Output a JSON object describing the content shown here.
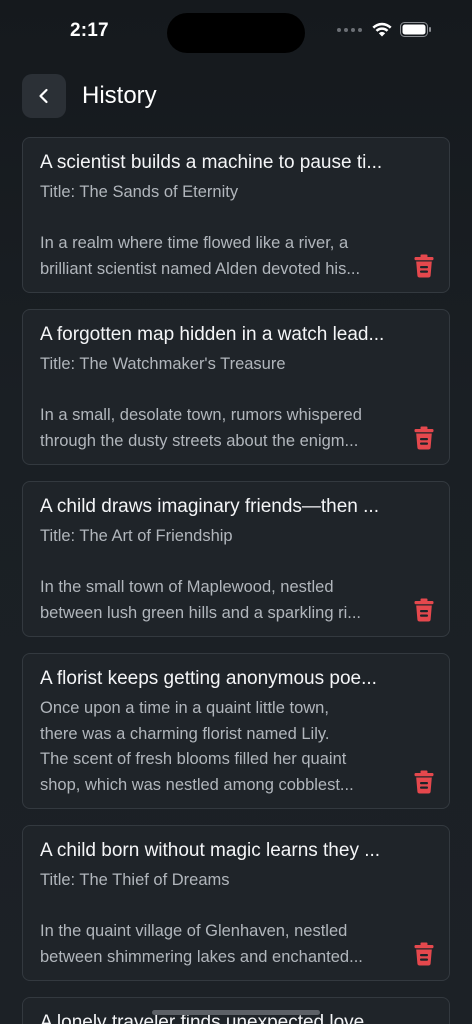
{
  "status_bar": {
    "time": "2:17"
  },
  "header": {
    "title": "History"
  },
  "colors": {
    "accent_delete": "#e5484d",
    "card_bg": "#1f2429",
    "background": "#15191d"
  },
  "history": [
    {
      "title": "A scientist builds a machine to pause ti...",
      "lines": [
        "Title: The Sands of Eternity",
        "",
        "In a realm where time flowed like a river, a",
        "brilliant scientist named Alden devoted his..."
      ]
    },
    {
      "title": "A forgotten map hidden in a watch lead...",
      "lines": [
        "Title: The Watchmaker's Treasure",
        "",
        "In a small, desolate town, rumors whispered",
        "through the dusty streets about the enigm..."
      ]
    },
    {
      "title": "A child draws imaginary friends—then ...",
      "lines": [
        "Title: The Art of Friendship",
        "",
        "In the small town of Maplewood, nestled",
        "between lush green hills and a sparkling ri..."
      ]
    },
    {
      "title": "A florist keeps getting anonymous poe...",
      "lines": [
        "Once upon a time in a quaint little town,",
        "there was a charming florist named Lily.",
        "The scent of fresh blooms filled her quaint",
        "shop, which was nestled among cobblest..."
      ]
    },
    {
      "title": "A child born without magic learns they ...",
      "lines": [
        "Title: The Thief of Dreams",
        "",
        "In the quaint village of Glenhaven, nestled",
        "between shimmering lakes and enchanted..."
      ]
    },
    {
      "title": "A lonely traveler finds unexpected love...",
      "lines": []
    }
  ]
}
